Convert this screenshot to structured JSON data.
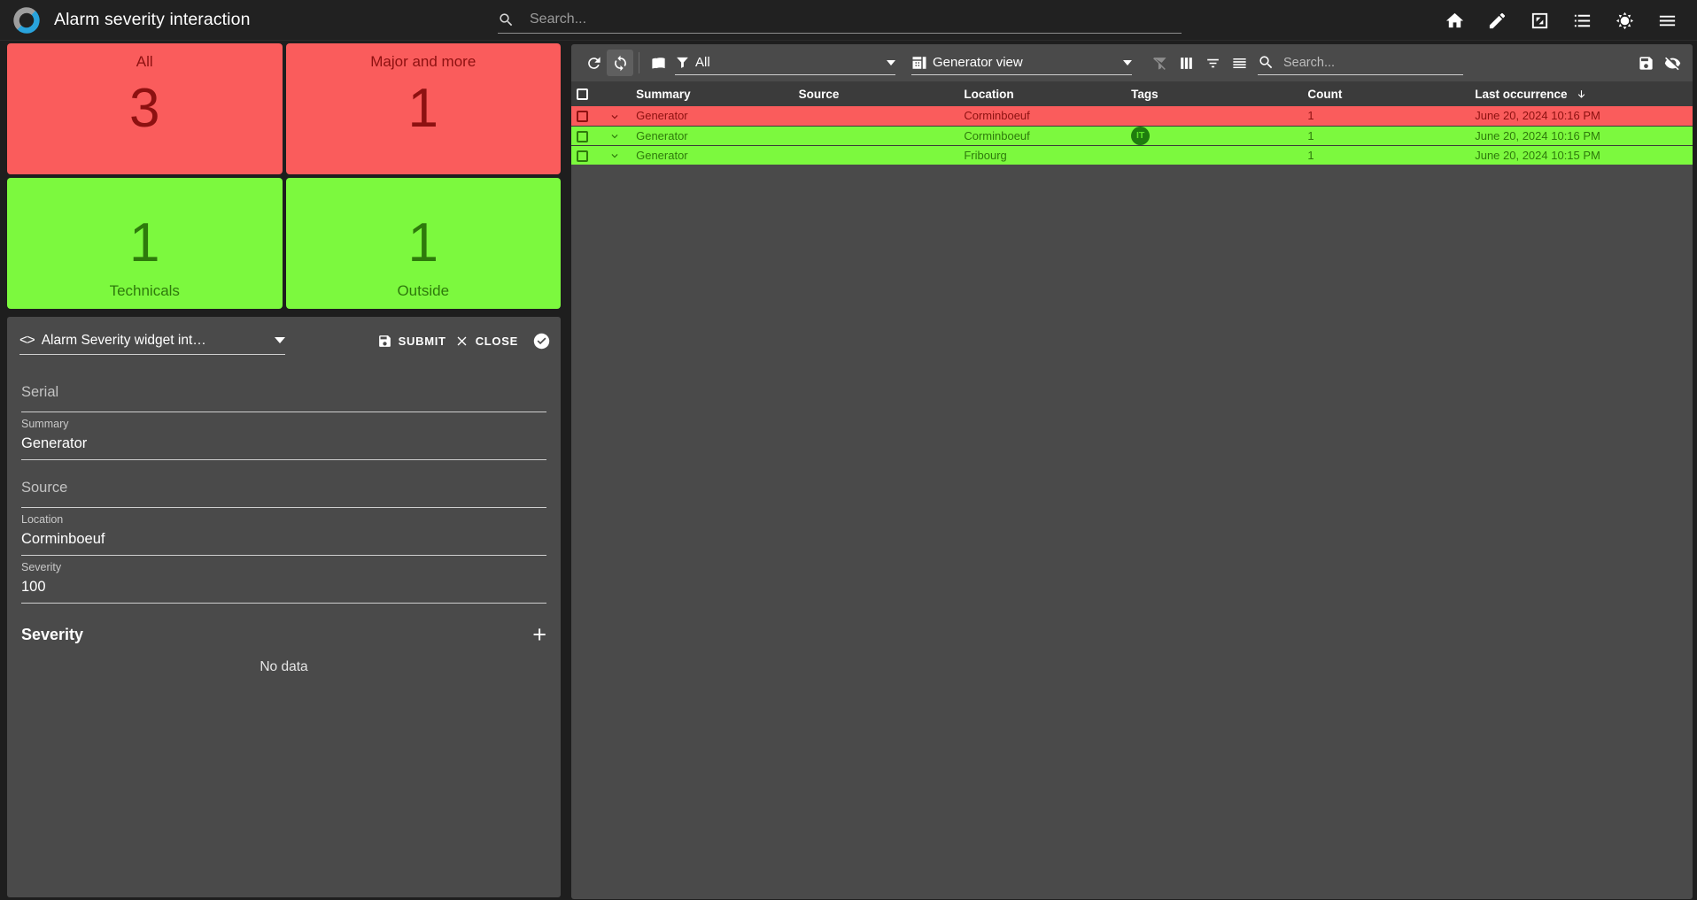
{
  "colors": {
    "severity_red": "#fa5c5c",
    "severity_red_text": "#8d1111",
    "severity_green": "#7cf93e",
    "severity_green_text": "#2e7a0c",
    "panel": "#4a4a4a",
    "appbar": "#212121",
    "background": "#1e1e1e",
    "tag_badge": "#1f7d0e"
  },
  "appbar": {
    "logo_icon": "s-logo-icon",
    "title": "Alarm severity interaction",
    "search": {
      "placeholder": "Search...",
      "value": "",
      "icon": "search-icon"
    },
    "icons": [
      {
        "name": "home-icon",
        "label": "Home"
      },
      {
        "name": "pencil-icon",
        "label": "Edit"
      },
      {
        "name": "fullscreen-icon",
        "label": "Fullscreen"
      },
      {
        "name": "list-icon",
        "label": "List"
      },
      {
        "name": "brightness-icon",
        "label": "Theme"
      },
      {
        "name": "hamburger-menu-icon",
        "label": "Menu"
      }
    ]
  },
  "tiles": [
    {
      "label": "All",
      "value": "3",
      "severity": "red",
      "label_pos": "top"
    },
    {
      "label": "Major and more",
      "value": "1",
      "severity": "red",
      "label_pos": "top"
    },
    {
      "label": "Technicals",
      "value": "1",
      "severity": "green",
      "label_pos": "bottom"
    },
    {
      "label": "Outside",
      "value": "1",
      "severity": "green",
      "label_pos": "bottom"
    }
  ],
  "form": {
    "code_icon": "code-brackets-icon",
    "selected_form": "Alarm Severity widget int…",
    "submit_label": "SUBMIT",
    "submit_icon": "save-icon",
    "close_label": "CLOSE",
    "close_icon": "close-x-icon",
    "valid_icon": "check-circle-icon",
    "fields": [
      {
        "label": "Serial",
        "value": "",
        "empty": true
      },
      {
        "label": "Summary",
        "value": "Generator",
        "empty": false
      },
      {
        "label": "Source",
        "value": "",
        "empty": true
      },
      {
        "label": "Location",
        "value": "Corminboeuf",
        "empty": false
      },
      {
        "label": "Severity",
        "value": "100",
        "empty": false
      }
    ],
    "section": {
      "title": "Severity",
      "add_icon": "plus-icon",
      "empty_text": "No data"
    }
  },
  "alarms_panel": {
    "toolbar": {
      "refresh_icon": "refresh-icon",
      "autorefresh_icon": "auto-refresh-icon",
      "autorefresh_active": true,
      "book_icon": "book-icon",
      "filter_icon": "filter-icon",
      "filter_value": "All",
      "view_icon": "table-view-icon",
      "view_value": "Generator view",
      "filter_off_icon": "filter-off-icon",
      "columns_icon": "columns-icon",
      "filter_list_icon": "filter-list-icon",
      "density_icon": "density-icon",
      "search_icon": "search-icon",
      "search_placeholder": "Search...",
      "search_value": "",
      "save_icon": "save-icon",
      "hide_icon": "eye-off-icon"
    },
    "table": {
      "columns": [
        "Summary",
        "Source",
        "Location",
        "Tags",
        "Count",
        "Last occurrence"
      ],
      "sort_column": "Last occurrence",
      "sort_direction": "desc",
      "rows": [
        {
          "severity": "red",
          "summary": "Generator",
          "source": "",
          "location": "Corminboeuf",
          "tags": [],
          "count": "1",
          "last_occurrence": "June 20, 2024 10:16 PM",
          "selected": false
        },
        {
          "severity": "green",
          "summary": "Generator",
          "source": "",
          "location": "Corminboeuf",
          "tags": [
            "IT"
          ],
          "count": "1",
          "last_occurrence": "June 20, 2024 10:16 PM",
          "selected": false
        },
        {
          "severity": "green",
          "summary": "Generator",
          "source": "",
          "location": "Fribourg",
          "tags": [],
          "count": "1",
          "last_occurrence": "June 20, 2024 10:15 PM",
          "selected": false
        }
      ]
    }
  }
}
